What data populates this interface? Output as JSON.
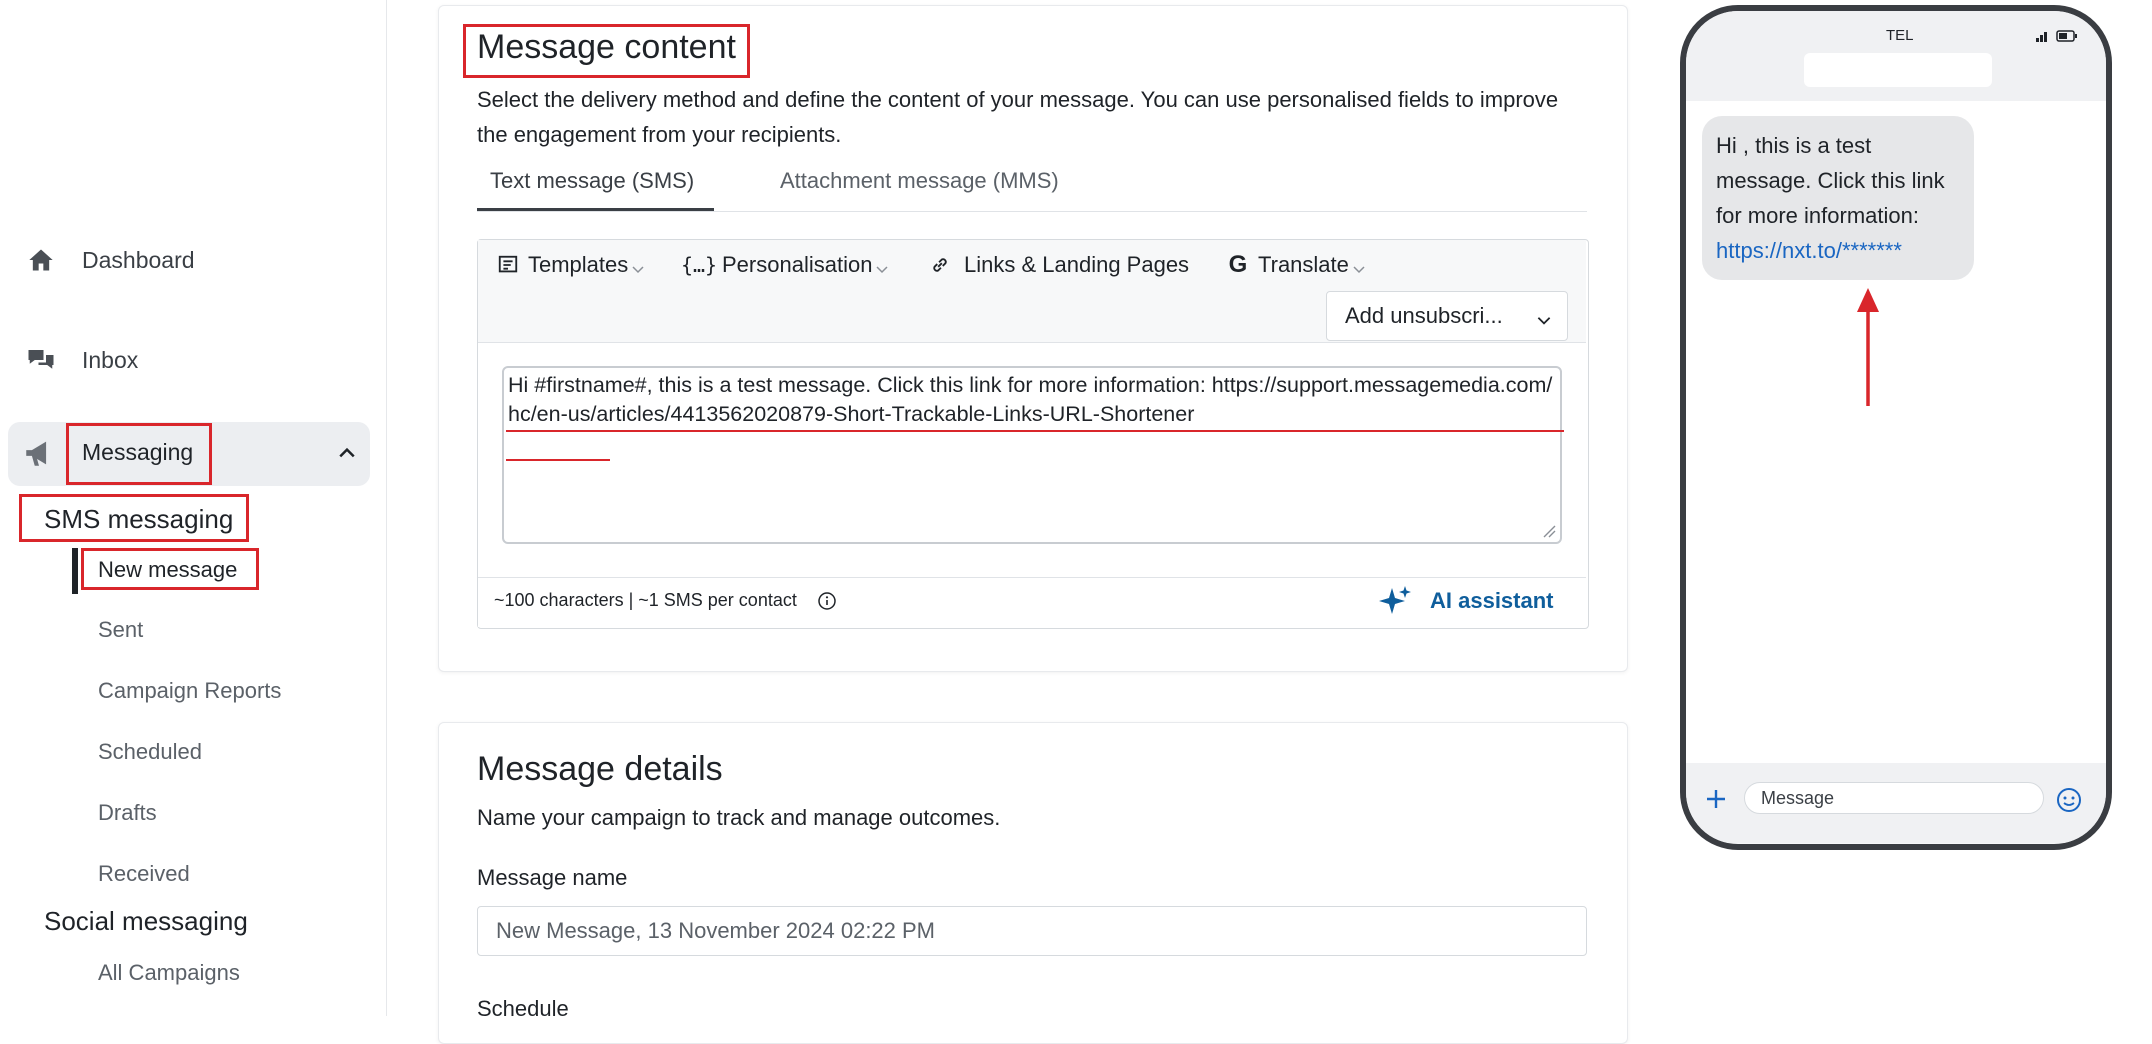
{
  "sidebar": {
    "items": [
      {
        "label": "Dashboard",
        "icon": "home-icon"
      },
      {
        "label": "Inbox",
        "icon": "chat-bubbles-icon"
      },
      {
        "label": "Messaging",
        "icon": "megaphone-icon"
      }
    ],
    "sms_heading": "SMS messaging",
    "sms_items": [
      "New message",
      "Sent",
      "Campaign Reports",
      "Scheduled",
      "Drafts",
      "Received"
    ],
    "social_heading": "Social messaging",
    "social_items": [
      "All Campaigns"
    ]
  },
  "content": {
    "title": "Message content",
    "description": "Select the delivery method and define the content of your message. You can use personalised fields to improve the engagement from your recipients.",
    "tabs": [
      "Text message (SMS)",
      "Attachment message (MMS)"
    ],
    "toolbar": {
      "templates": "Templates",
      "personalisation": "Personalisation",
      "links": "Links & Landing Pages",
      "translate": "Translate",
      "unsubscribe": "Add unsubscri..."
    },
    "message_text": "Hi #firstname#, this is a test message. Click this link for more information: https://support.messagemedia.com/hc/en-us/articles/4413562020879-Short-Trackable-Links-URL-Shortener",
    "char_count": "~100 characters | ~1 SMS per contact",
    "ai_assistant": "AI assistant"
  },
  "details": {
    "title": "Message details",
    "description": "Name your campaign to track and manage outcomes.",
    "name_label": "Message name",
    "name_value": "New Message, 13 November 2024 02:22 PM",
    "schedule_label": "Schedule"
  },
  "phone": {
    "carrier": "TEL",
    "bubble_text": "Hi , this is a test message. Click this link for more information:",
    "bubble_link": "https://nxt.to/*******",
    "input_placeholder": "Message"
  },
  "colors": {
    "annotation_red": "#d9262b",
    "ai_blue": "#0f5e9c",
    "link_blue": "#1a66c2"
  }
}
